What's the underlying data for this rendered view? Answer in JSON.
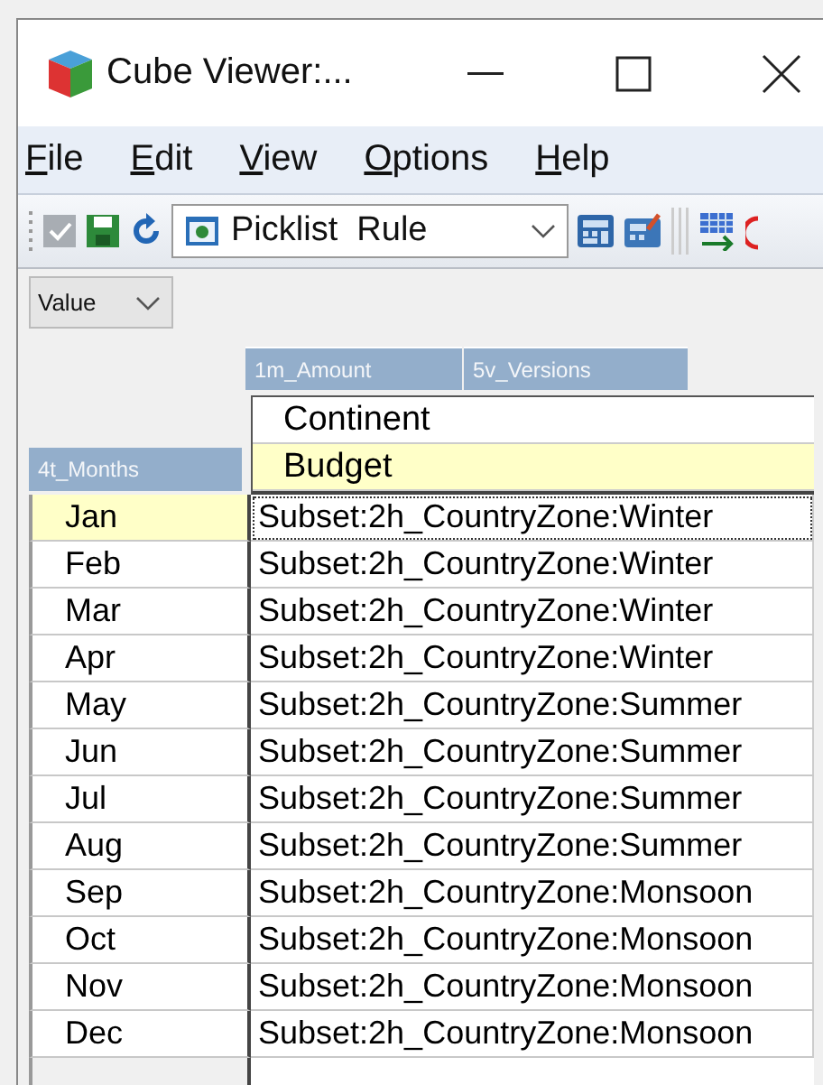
{
  "window": {
    "title": "Cube Viewer:..."
  },
  "menu": [
    "File",
    "Edit",
    "View",
    "Options",
    "Help"
  ],
  "toolbar": {
    "view_select": "Picklist  Rule"
  },
  "value_select": "Value",
  "column_dimensions": [
    "1m_Amount",
    "5v_Versions"
  ],
  "row_dimension": "4t_Months",
  "column_headers": [
    {
      "label": "Continent",
      "selected": false
    },
    {
      "label": "Budget",
      "selected": true
    }
  ],
  "rows": [
    {
      "label": "Jan",
      "value": "Subset:2h_CountryZone:Winter",
      "selected": true
    },
    {
      "label": "Feb",
      "value": "Subset:2h_CountryZone:Winter",
      "selected": false
    },
    {
      "label": "Mar",
      "value": "Subset:2h_CountryZone:Winter",
      "selected": false
    },
    {
      "label": "Apr",
      "value": "Subset:2h_CountryZone:Winter",
      "selected": false
    },
    {
      "label": "May",
      "value": "Subset:2h_CountryZone:Summer",
      "selected": false
    },
    {
      "label": "Jun",
      "value": "Subset:2h_CountryZone:Summer",
      "selected": false
    },
    {
      "label": "Jul",
      "value": "Subset:2h_CountryZone:Summer",
      "selected": false
    },
    {
      "label": "Aug",
      "value": "Subset:2h_CountryZone:Summer",
      "selected": false
    },
    {
      "label": "Sep",
      "value": "Subset:2h_CountryZone:Monsoon",
      "selected": false
    },
    {
      "label": "Oct",
      "value": "Subset:2h_CountryZone:Monsoon",
      "selected": false
    },
    {
      "label": "Nov",
      "value": "Subset:2h_CountryZone:Monsoon",
      "selected": false
    },
    {
      "label": "Dec",
      "value": "Subset:2h_CountryZone:Monsoon",
      "selected": false
    }
  ]
}
